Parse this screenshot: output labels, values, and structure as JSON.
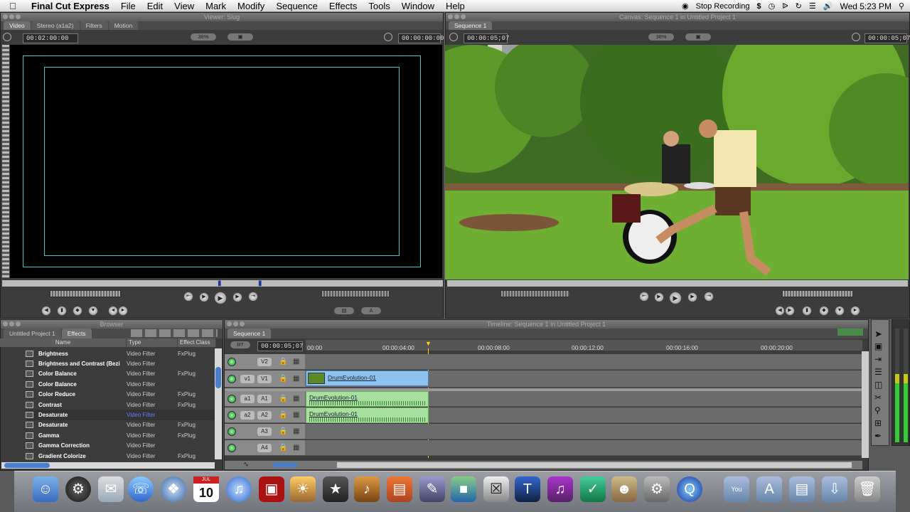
{
  "menubar": {
    "app_name": "Final Cut Express",
    "items": [
      "File",
      "Edit",
      "View",
      "Mark",
      "Modify",
      "Sequence",
      "Effects",
      "Tools",
      "Window",
      "Help"
    ],
    "stop_recording": "Stop Recording",
    "clock": "Wed 5:23 PM"
  },
  "viewer": {
    "title": "Viewer: Slug",
    "tabs": [
      "Video",
      "Stereo (a1a2)",
      "Filters",
      "Motion"
    ],
    "duration_tc": "00:02:00:00",
    "zoom": "36%",
    "current_tc": "00:00:00:00"
  },
  "canvas": {
    "title": "Canvas: Sequence 1 in Untitled Project 1",
    "tab": "Sequence 1",
    "duration_tc": "00:00:05;07",
    "zoom": "38%",
    "current_tc": "00:00:05;07"
  },
  "browser": {
    "title": "Browser",
    "tabs": [
      "Untitled Project 1",
      "Effects"
    ],
    "columns": [
      "Name",
      "Type",
      "Effect Class"
    ],
    "rows": [
      {
        "name": "Brightness",
        "type": "Video Filter",
        "cls": "FxPlug"
      },
      {
        "name": "Brightness and Contrast (Bezi",
        "type": "Video Filter",
        "cls": ""
      },
      {
        "name": "Color Balance",
        "type": "Video Filter",
        "cls": "FxPlug"
      },
      {
        "name": "Color Balance",
        "type": "Video Filter",
        "cls": ""
      },
      {
        "name": "Color Reduce",
        "type": "Video Filter",
        "cls": "FxPlug"
      },
      {
        "name": "Contrast",
        "type": "Video Filter",
        "cls": "FxPlug"
      },
      {
        "name": "Desaturate",
        "type": "Video Filter",
        "cls": ""
      },
      {
        "name": "Desaturate",
        "type": "Video Filter",
        "cls": "FxPlug"
      },
      {
        "name": "Gamma",
        "type": "Video Filter",
        "cls": "FxPlug"
      },
      {
        "name": "Gamma Correction",
        "type": "Video Filter",
        "cls": ""
      },
      {
        "name": "Gradient Colorize",
        "type": "Video Filter",
        "cls": "FxPlug"
      }
    ]
  },
  "timeline": {
    "title": "Timeline: Sequence 1 in Untitled Project 1",
    "tab": "Sequence 1",
    "rt": "RT",
    "current_tc": "00:00:05;07",
    "ruler": [
      "00:00",
      "00:00:04:00",
      "00:00:08:00",
      "00:00:12:00",
      "00:00:16:00",
      "00:00:20:00"
    ],
    "video_tracks": [
      {
        "src": "",
        "dst": "V2"
      },
      {
        "src": "v1",
        "dst": "V1"
      }
    ],
    "audio_tracks": [
      {
        "src": "a1",
        "dst": "A1"
      },
      {
        "src": "a2",
        "dst": "A2"
      },
      {
        "src": "",
        "dst": "A3"
      },
      {
        "src": "",
        "dst": "A4"
      }
    ],
    "clip_name": "DrumEvolution-01"
  },
  "dock": {
    "calendar_month": "JUL",
    "calendar_day": "10"
  }
}
